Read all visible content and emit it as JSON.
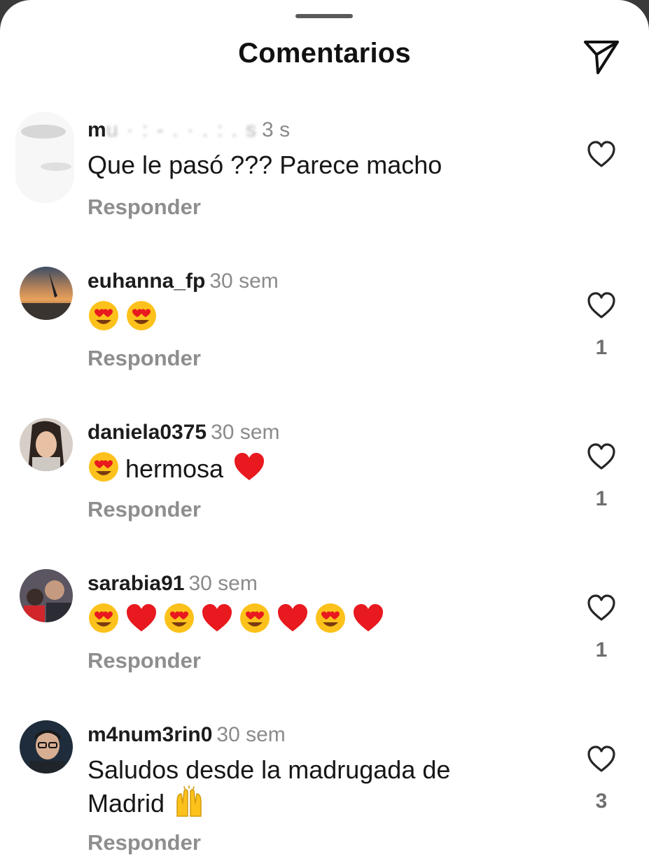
{
  "header": {
    "title": "Comentarios",
    "send_icon": "send-icon"
  },
  "comments": [
    {
      "username": "m",
      "username_blurred": "u  ·  :  -  .  ·  .  :  .  s",
      "time": "3 s",
      "text": "Que le pasó ??? Parece macho",
      "reply": "Responder",
      "likes": ""
    },
    {
      "username": "euhanna_fp",
      "time": "30 sem",
      "emojis": [
        "heart-eyes",
        "heart-eyes"
      ],
      "reply": "Responder",
      "likes": "1"
    },
    {
      "username": "daniela0375",
      "time": "30 sem",
      "text": "hermosa",
      "reply": "Responder",
      "likes": "1"
    },
    {
      "username": "sarabia91",
      "time": "30 sem",
      "emojis": [
        "heart-eyes",
        "red-heart",
        "heart-eyes",
        "red-heart",
        "heart-eyes",
        "red-heart",
        "heart-eyes",
        "red-heart"
      ],
      "reply": "Responder",
      "likes": "1"
    },
    {
      "username": "m4num3rin0",
      "time": "30 sem",
      "text_line1": "Saludos desde la madrugada de",
      "text_line2": "Madrid",
      "reply": "Responder",
      "likes": "3"
    }
  ],
  "colors": {
    "text": "#161616",
    "secondary": "#8e8e8e",
    "heart_red": "#e8191f",
    "emoji_yellow": "#fcc21b"
  }
}
